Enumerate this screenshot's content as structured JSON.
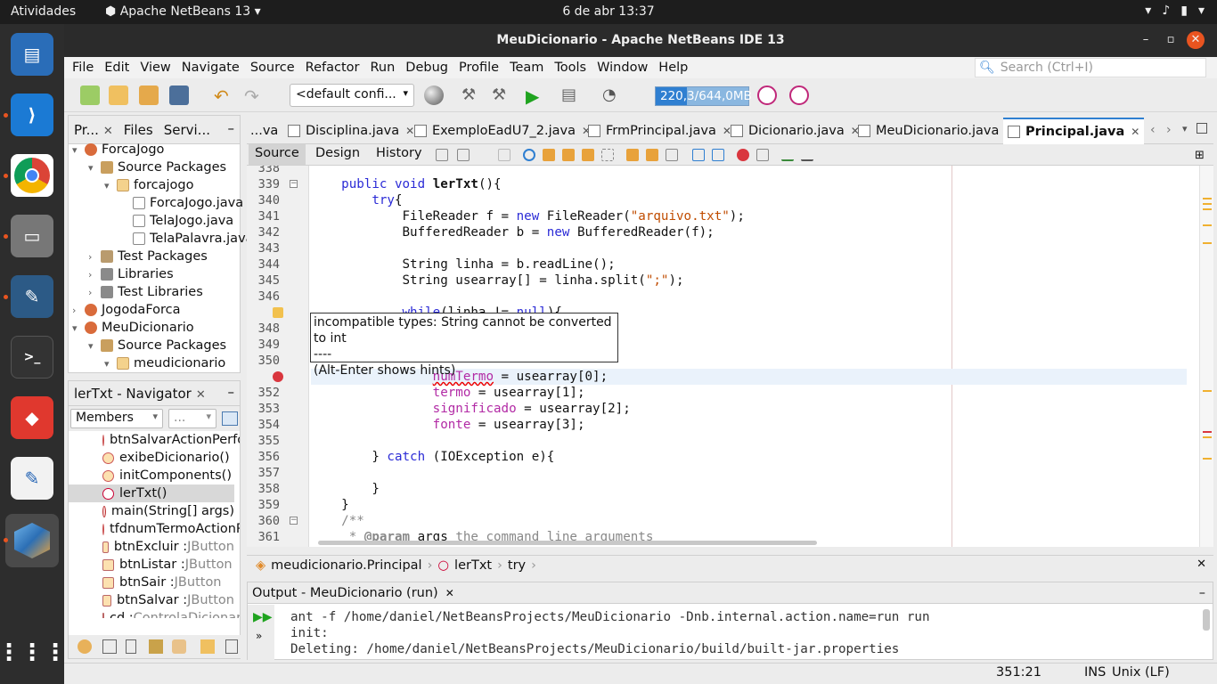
{
  "topbar": {
    "activities": "Atividades",
    "app_name": "Apache NetBeans 13",
    "clock": "6 de abr  13:37"
  },
  "window": {
    "title": "MeuDicionario - Apache NetBeans IDE 13"
  },
  "menu": [
    "File",
    "Edit",
    "View",
    "Navigate",
    "Source",
    "Refactor",
    "Run",
    "Debug",
    "Profile",
    "Team",
    "Tools",
    "Window",
    "Help"
  ],
  "search": {
    "placeholder": "Search (Ctrl+I)"
  },
  "toolbar": {
    "config": "<default confi...",
    "memory": "220,3/644,0MB",
    "memory_fraction": 0.34
  },
  "projects_panel": {
    "tabs": [
      "Pr...",
      "Files",
      "Servi..."
    ],
    "tree": [
      {
        "label": "ForcaJogo",
        "icon": "project-icon"
      },
      {
        "label": "Source Packages",
        "icon": "source-packages-icon"
      },
      {
        "label": "forcajogo",
        "icon": "package-icon"
      },
      {
        "label": "ForcaJogo.java",
        "icon": "java-file-icon"
      },
      {
        "label": "TelaJogo.java",
        "icon": "java-file-icon"
      },
      {
        "label": "TelaPalavra.java",
        "icon": "java-file-icon"
      },
      {
        "label": "Test Packages",
        "icon": "test-packages-icon"
      },
      {
        "label": "Libraries",
        "icon": "libraries-icon"
      },
      {
        "label": "Test Libraries",
        "icon": "libraries-icon"
      },
      {
        "label": "JogodaForca",
        "icon": "project-icon"
      },
      {
        "label": "MeuDicionario",
        "icon": "project-icon"
      },
      {
        "label": "Source Packages",
        "icon": "source-packages-icon"
      },
      {
        "label": "meudicionario",
        "icon": "package-icon"
      }
    ]
  },
  "navigator": {
    "title": "lerTxt - Navigator",
    "filter": "Members",
    "filter2": "...",
    "members": [
      {
        "name": "btnSalvarActionPerformed",
        "type": ""
      },
      {
        "name": "exibeDicionario()",
        "type": ""
      },
      {
        "name": "initComponents()",
        "type": ""
      },
      {
        "name": "lerTxt()",
        "type": ""
      },
      {
        "name": "main(String[] args)",
        "type": ""
      },
      {
        "name": "tfdnumTermoActionPerformed",
        "type": ""
      },
      {
        "name": "btnExcluir : ",
        "type": "JButton"
      },
      {
        "name": "btnListar : ",
        "type": "JButton"
      },
      {
        "name": "btnSair : ",
        "type": "JButton"
      },
      {
        "name": "btnSalvar : ",
        "type": "JButton"
      },
      {
        "name": "cd : ",
        "type": "ControlaDicionario"
      }
    ]
  },
  "editor_tabs": [
    {
      "label": "...va"
    },
    {
      "label": "Disciplina.java"
    },
    {
      "label": "ExemploEadU7_2.java"
    },
    {
      "label": "FrmPrincipal.java"
    },
    {
      "label": "Dicionario.java"
    },
    {
      "label": "MeuDicionario.java"
    },
    {
      "label": "Principal.java"
    }
  ],
  "editor_toolbar": {
    "source": "Source",
    "design": "Design",
    "history": "History"
  },
  "code": {
    "line_numbers": [
      "338",
      "339",
      "340",
      "341",
      "342",
      "343",
      "344",
      "345",
      "346",
      "347",
      "348",
      "349",
      "350",
      "351",
      "352",
      "353",
      "354",
      "355",
      "356",
      "357",
      "358",
      "359",
      "360",
      "361"
    ],
    "tooltip": [
      "incompatible types: String cannot be converted to int",
      "----",
      "(Alt-Enter shows hints)"
    ]
  },
  "breadcrumb": [
    "meudicionario.Principal",
    "lerTxt",
    "try"
  ],
  "output": {
    "title": "Output - MeuDicionario (run)",
    "lines": [
      "ant -f /home/daniel/NetBeansProjects/MeuDicionario -Dnb.internal.action.name=run run",
      "init:",
      "Deleting: /home/daniel/NetBeansProjects/MeuDicionario/build/built-jar.properties"
    ]
  },
  "status": {
    "position": "351:21",
    "insert_mode": "INS",
    "line_ending": "Unix (LF)"
  }
}
